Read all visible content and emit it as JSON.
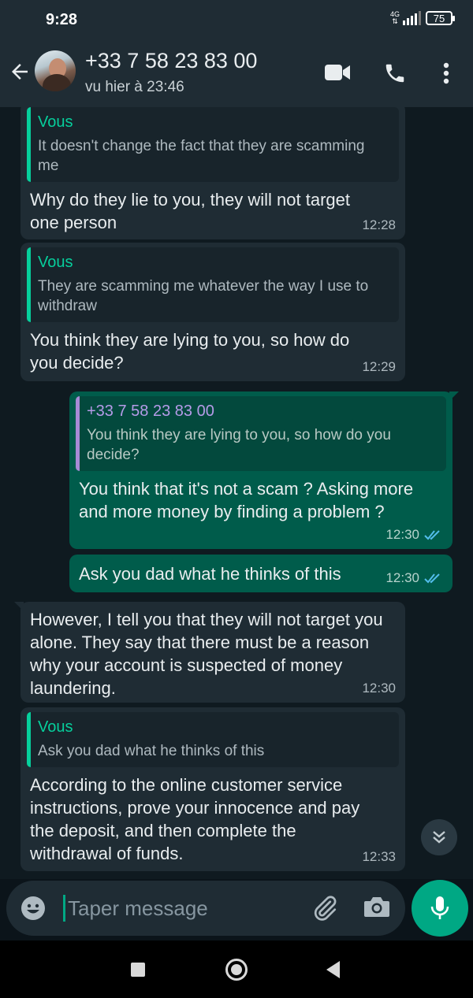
{
  "status_bar": {
    "time": "9:28",
    "network": "4G",
    "battery": "75"
  },
  "header": {
    "contact_name": "+33 7 58 23 83 00",
    "last_seen": "vu hier à 23:46",
    "icons": [
      "back-arrow-icon",
      "video-call-icon",
      "phone-icon",
      "more-vert-icon"
    ]
  },
  "messages": [
    {
      "direction": "in",
      "quote_author": "Vous",
      "quote_text": "It doesn't change the fact that they are scamming me",
      "text": "Why do they lie to you, they will not target one person",
      "time": "12:28"
    },
    {
      "direction": "in",
      "quote_author": "Vous",
      "quote_text": "They are scamming me whatever the way I use to withdraw",
      "text": "You think they are lying to you, so how do you decide?",
      "time": "12:29"
    },
    {
      "direction": "out",
      "quote_author": "+33 7 58 23 83 00",
      "quote_text": "You think they are lying to you, so how do you decide?",
      "text": "You think that it's not a scam ? Asking more and more money by finding a problem ?",
      "time": "12:30",
      "status": "read"
    },
    {
      "direction": "out",
      "text": "Ask you dad what he thinks of this",
      "time": "12:30",
      "status": "read"
    },
    {
      "direction": "in",
      "text": "However, I tell you that they will not target you alone. They say that there must be a reason why your account is suspected of money laundering.",
      "time": "12:30"
    },
    {
      "direction": "in",
      "quote_author": "Vous",
      "quote_text": "Ask you dad what he thinks of this",
      "text": "According to the online customer service instructions, prove your innocence and pay the deposit, and then complete the withdrawal of funds.",
      "time": "12:33"
    }
  ],
  "composer": {
    "placeholder": "Taper message",
    "icons": [
      "emoji-icon",
      "attach-icon",
      "camera-icon",
      "mic-icon"
    ]
  },
  "colors": {
    "incoming_bubble": "#1f2c34",
    "outgoing_bubble": "#005c4b",
    "accent": "#00a884",
    "quote_green": "#06cf9c",
    "quote_purple": "#b59be8",
    "read_tick": "#53bdeb"
  }
}
